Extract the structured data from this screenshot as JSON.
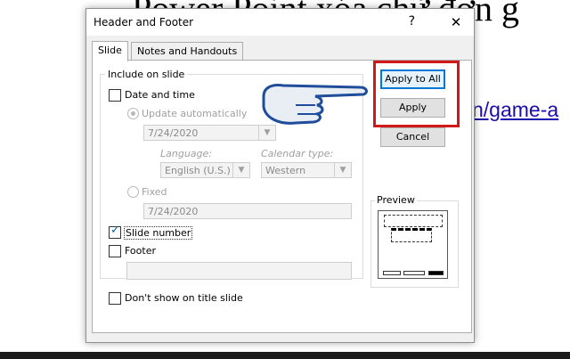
{
  "background": {
    "doc_title": "Power Point xóa chữ đơn g",
    "doc_link": "n/game-a"
  },
  "dialog": {
    "title": "Header and Footer",
    "help": "?",
    "close": "✕",
    "tabs": [
      {
        "label": "Slide",
        "active": true
      },
      {
        "label": "Notes and Handouts",
        "active": false
      }
    ],
    "include_group": {
      "label": "Include on slide",
      "date_time": {
        "label": "Date and time",
        "checked": false
      },
      "update_auto": {
        "label": "Update automatically",
        "selected": true,
        "disabled": true,
        "value": "7/24/2020"
      },
      "language": {
        "label": "Language:",
        "value": "English (U.S.)"
      },
      "calendar": {
        "label": "Calendar type:",
        "value": "Western"
      },
      "fixed": {
        "label": "Fixed",
        "selected": false,
        "disabled": true,
        "value": "7/24/2020"
      },
      "slide_number": {
        "label": "Slide number",
        "checked": true
      },
      "footer": {
        "label": "Footer",
        "checked": false,
        "value": ""
      }
    },
    "dont_show_title": {
      "label": "Don't show on title slide",
      "checked": false
    },
    "buttons": {
      "apply_all": "Apply to All",
      "apply": "Apply",
      "cancel": "Cancel"
    },
    "preview_label": "Preview",
    "icons": {
      "checkmark": "check-icon",
      "dropdown": "chevron-down-icon",
      "pointer": "pointing-hand-icon"
    }
  },
  "colors": {
    "highlight": "#d01a1a",
    "accent": "#0078d7",
    "link": "#1a0dab"
  }
}
